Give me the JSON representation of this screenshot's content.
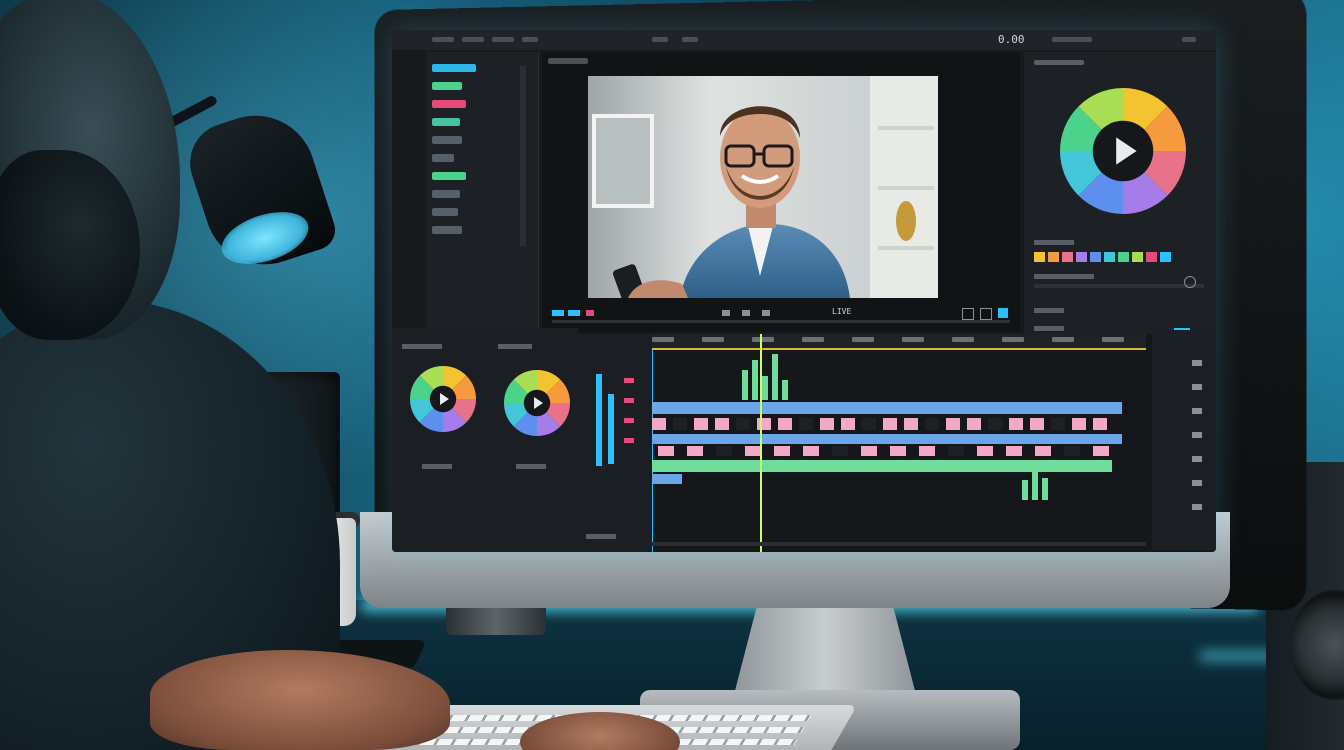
{
  "screen": {
    "timecode": "0.00",
    "viewer_label": "LIVE"
  },
  "colors": {
    "accent": "#2cc0ff",
    "clip_blue": "#6aa6e8",
    "clip_pink": "#f2a9c4",
    "clip_green": "#6fdc9a",
    "ruler_yellow": "#d9b93a",
    "playhead": "#c9ff6a",
    "wheel": [
      "#f4c430",
      "#f59a3d",
      "#e8728a",
      "#a67de8",
      "#5d8fee",
      "#42c6d8",
      "#4bd38c",
      "#a9dd53"
    ]
  },
  "icons": {
    "play": "play-icon",
    "settings": "gear-icon"
  }
}
